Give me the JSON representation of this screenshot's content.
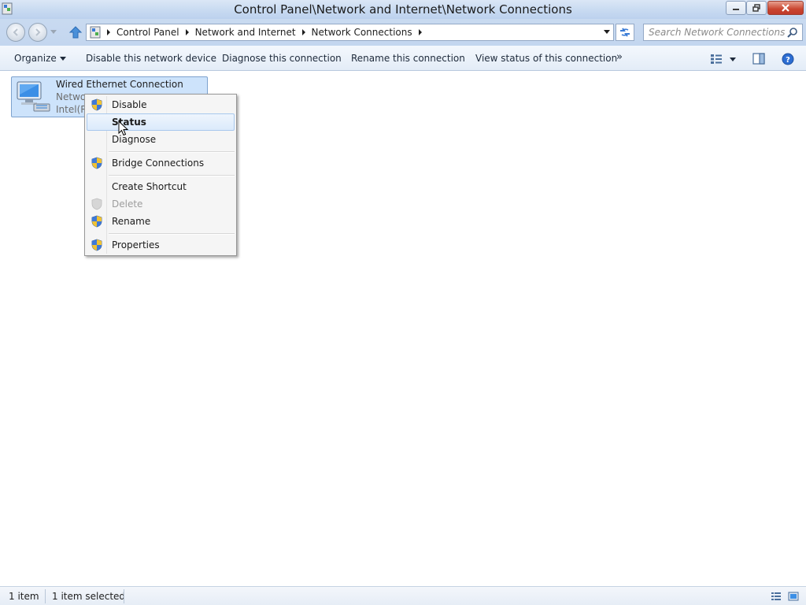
{
  "window": {
    "title": "Control Panel\\Network and Internet\\Network Connections",
    "controls": [
      "minimize",
      "maximize",
      "close"
    ]
  },
  "address_bar": {
    "breadcrumbs": [
      "Control Panel",
      "Network and Internet",
      "Network Connections"
    ]
  },
  "search": {
    "placeholder": "Search Network Connections"
  },
  "command_bar": {
    "organize": "Organize",
    "disable": "Disable this network device",
    "diagnose": "Diagnose this connection",
    "rename": "Rename this connection",
    "view_status": "View status of this connection",
    "more": "»"
  },
  "connection": {
    "name": "Wired Ethernet Connection",
    "status_truncated": "Netwo",
    "adapter_truncated": "Intel(R)"
  },
  "context_menu": {
    "items": [
      {
        "label": "Disable",
        "shield": true,
        "state": "normal"
      },
      {
        "label": "Status",
        "shield": false,
        "state": "hover"
      },
      {
        "label": "Diagnose",
        "shield": false,
        "state": "normal"
      },
      {
        "label": "Bridge Connections",
        "shield": true,
        "state": "normal"
      },
      {
        "label": "Create Shortcut",
        "shield": false,
        "state": "normal"
      },
      {
        "label": "Delete",
        "shield": true,
        "state": "disabled"
      },
      {
        "label": "Rename",
        "shield": true,
        "state": "normal"
      },
      {
        "label": "Properties",
        "shield": true,
        "state": "normal"
      }
    ]
  },
  "status_bar": {
    "item_count": "1 item",
    "selected": "1 item selected"
  },
  "colors": {
    "selection": "#cde3fb",
    "hover_border": "#a8c8ed",
    "titlebar": "#c8daf1",
    "close_button": "#c9452f"
  }
}
